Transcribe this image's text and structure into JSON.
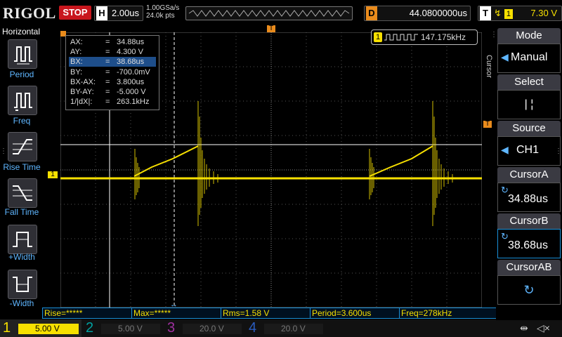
{
  "top": {
    "brand": "RIGOL",
    "run_state": "STOP",
    "horizontal": {
      "key": "H",
      "value": "2.00us"
    },
    "sample_rate": "1.00GSa/s",
    "mem_depth": "24.0k pts",
    "delay": {
      "key": "D",
      "value": "44.0800000us"
    },
    "trigger": {
      "key": "T",
      "edge": "↯",
      "channel": "1",
      "level": "7.30 V"
    }
  },
  "left_panel": {
    "title": "Horizontal",
    "items": [
      {
        "label": "Period"
      },
      {
        "label": "Freq"
      },
      {
        "label": "Rise Time"
      },
      {
        "label": "Fall Time"
      },
      {
        "label": "+Width"
      },
      {
        "label": "-Width"
      }
    ]
  },
  "cursor_readout": [
    {
      "name": "AX:",
      "eq": "=",
      "value": "34.88us"
    },
    {
      "name": "AY:",
      "eq": "=",
      "value": "4.300 V"
    },
    {
      "name": "BX:",
      "eq": "=",
      "value": "38.68us"
    },
    {
      "name": "BY:",
      "eq": "=",
      "value": "-700.0mV"
    },
    {
      "name": "BX-AX:",
      "eq": "=",
      "value": "3.800us"
    },
    {
      "name": "BY-AY:",
      "eq": "=",
      "value": "-5.000 V"
    },
    {
      "name": "1/|dX|:",
      "eq": "=",
      "value": "263.1kHz"
    }
  ],
  "freq_counter": {
    "channel": "1",
    "value": "147.175kHz"
  },
  "measurements": [
    {
      "label": "Rise=*****"
    },
    {
      "label": "Max=*****"
    },
    {
      "label": "Rms=1.58 V"
    },
    {
      "label": "Period=3.600us"
    },
    {
      "label": "Freq=278kHz"
    }
  ],
  "channels": [
    {
      "num": "1",
      "scale": "5.00 V",
      "color": "#f7e000",
      "active": true
    },
    {
      "num": "2",
      "scale": "5.00 V",
      "color": "#00e0e0",
      "active": false
    },
    {
      "num": "3",
      "scale": "20.0 V",
      "color": "#e040e0",
      "active": false
    },
    {
      "num": "4",
      "scale": "20.0 V",
      "color": "#3a7cff",
      "active": false
    }
  ],
  "right_menu": {
    "side_title": "Cursor",
    "mode": {
      "title": "Mode",
      "value": "Manual"
    },
    "select": {
      "title": "Select",
      "value": "| ¦"
    },
    "source": {
      "title": "Source",
      "value": "CH1"
    },
    "cursor_a": {
      "title": "CursorA",
      "value": "34.88us"
    },
    "cursor_b": {
      "title": "CursorB",
      "value": "38.68us"
    },
    "cursor_ab": {
      "title": "CursorAB"
    }
  },
  "markers": {
    "ch1": "1",
    "trigger_level": "T",
    "trigger_pos": "T"
  },
  "colors": {
    "ch1": "#f7e000",
    "menu_accent": "#1a8fd6",
    "stop": "#c8161d",
    "delay": "#e98b1c"
  }
}
